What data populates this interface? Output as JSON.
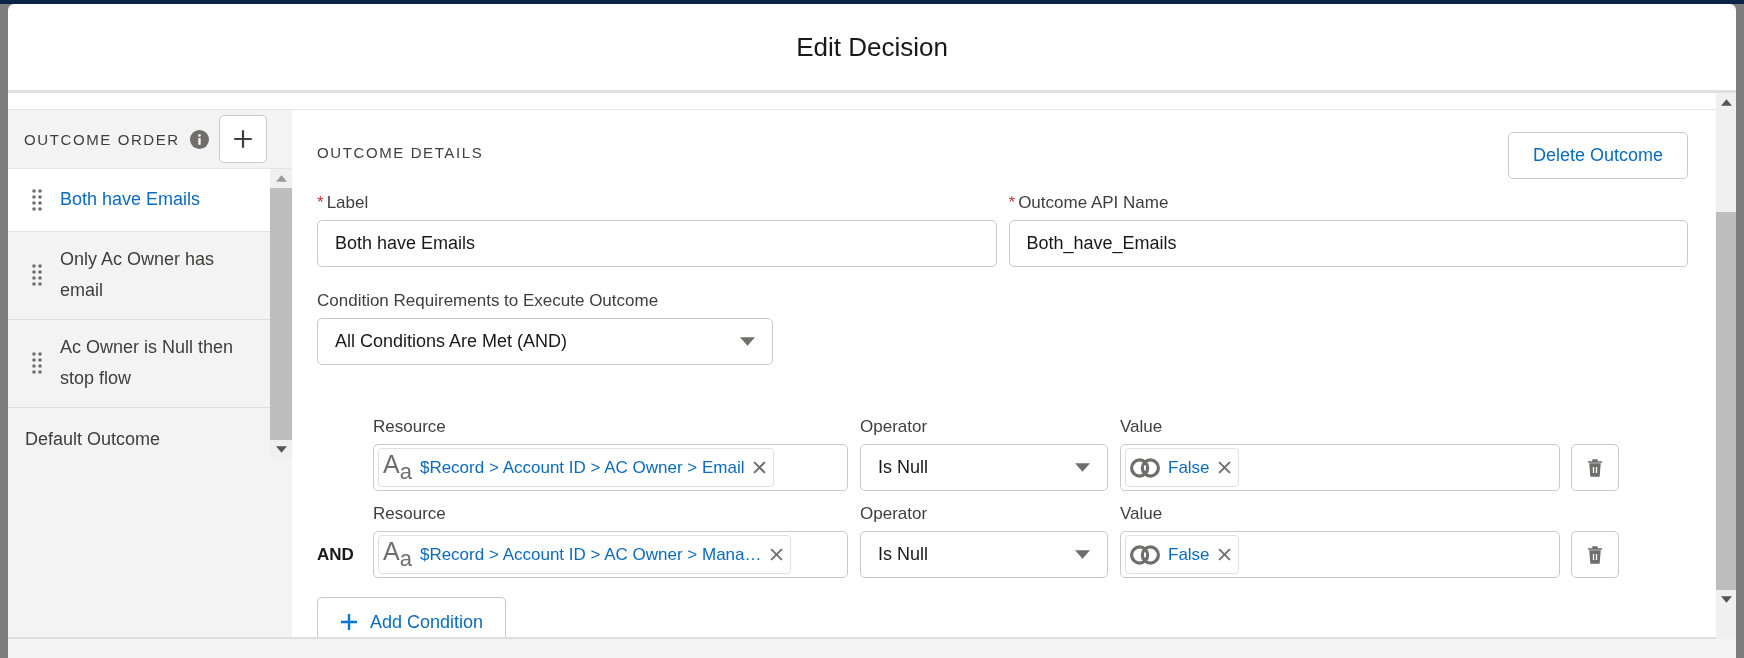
{
  "modal": {
    "title": "Edit Decision"
  },
  "outcome_order": {
    "heading": "OUTCOME ORDER",
    "items": [
      {
        "label": "Both have Emails",
        "selected": true,
        "kind": "draggable"
      },
      {
        "label": "Only Ac Owner has email",
        "selected": false,
        "kind": "draggable"
      },
      {
        "label": "Ac Owner is Null then stop flow",
        "selected": false,
        "kind": "draggable"
      },
      {
        "label": "Default Outcome",
        "selected": false,
        "kind": "default"
      }
    ]
  },
  "outcome_details": {
    "heading": "OUTCOME DETAILS",
    "delete_button": "Delete Outcome",
    "label_field": {
      "label": "Label",
      "required_mark": "*",
      "value": "Both have Emails"
    },
    "api_name_field": {
      "label": "Outcome API Name",
      "required_mark": "*",
      "value": "Both_have_Emails"
    },
    "condition_requirements": {
      "label": "Condition Requirements to Execute Outcome",
      "value": "All Conditions Are Met (AND)"
    },
    "conditions": [
      {
        "resource_label": "Resource",
        "type_icon": "A$_{a}$",
        "resource": "$Record > Account ID > AC Owner > Email",
        "operator_label": "Operator",
        "operator": "Is Null",
        "value_label": "Value",
        "value": "False"
      },
      {
        "connector": "AND",
        "resource_label": "Resource",
        "type_icon": "A$_{a}$",
        "resource": "$Record > Account ID > AC Owner > Mana…",
        "operator_label": "Operator",
        "operator": "Is Null",
        "value_label": "Value",
        "value": "False"
      }
    ],
    "add_condition_button": "Add Condition"
  }
}
